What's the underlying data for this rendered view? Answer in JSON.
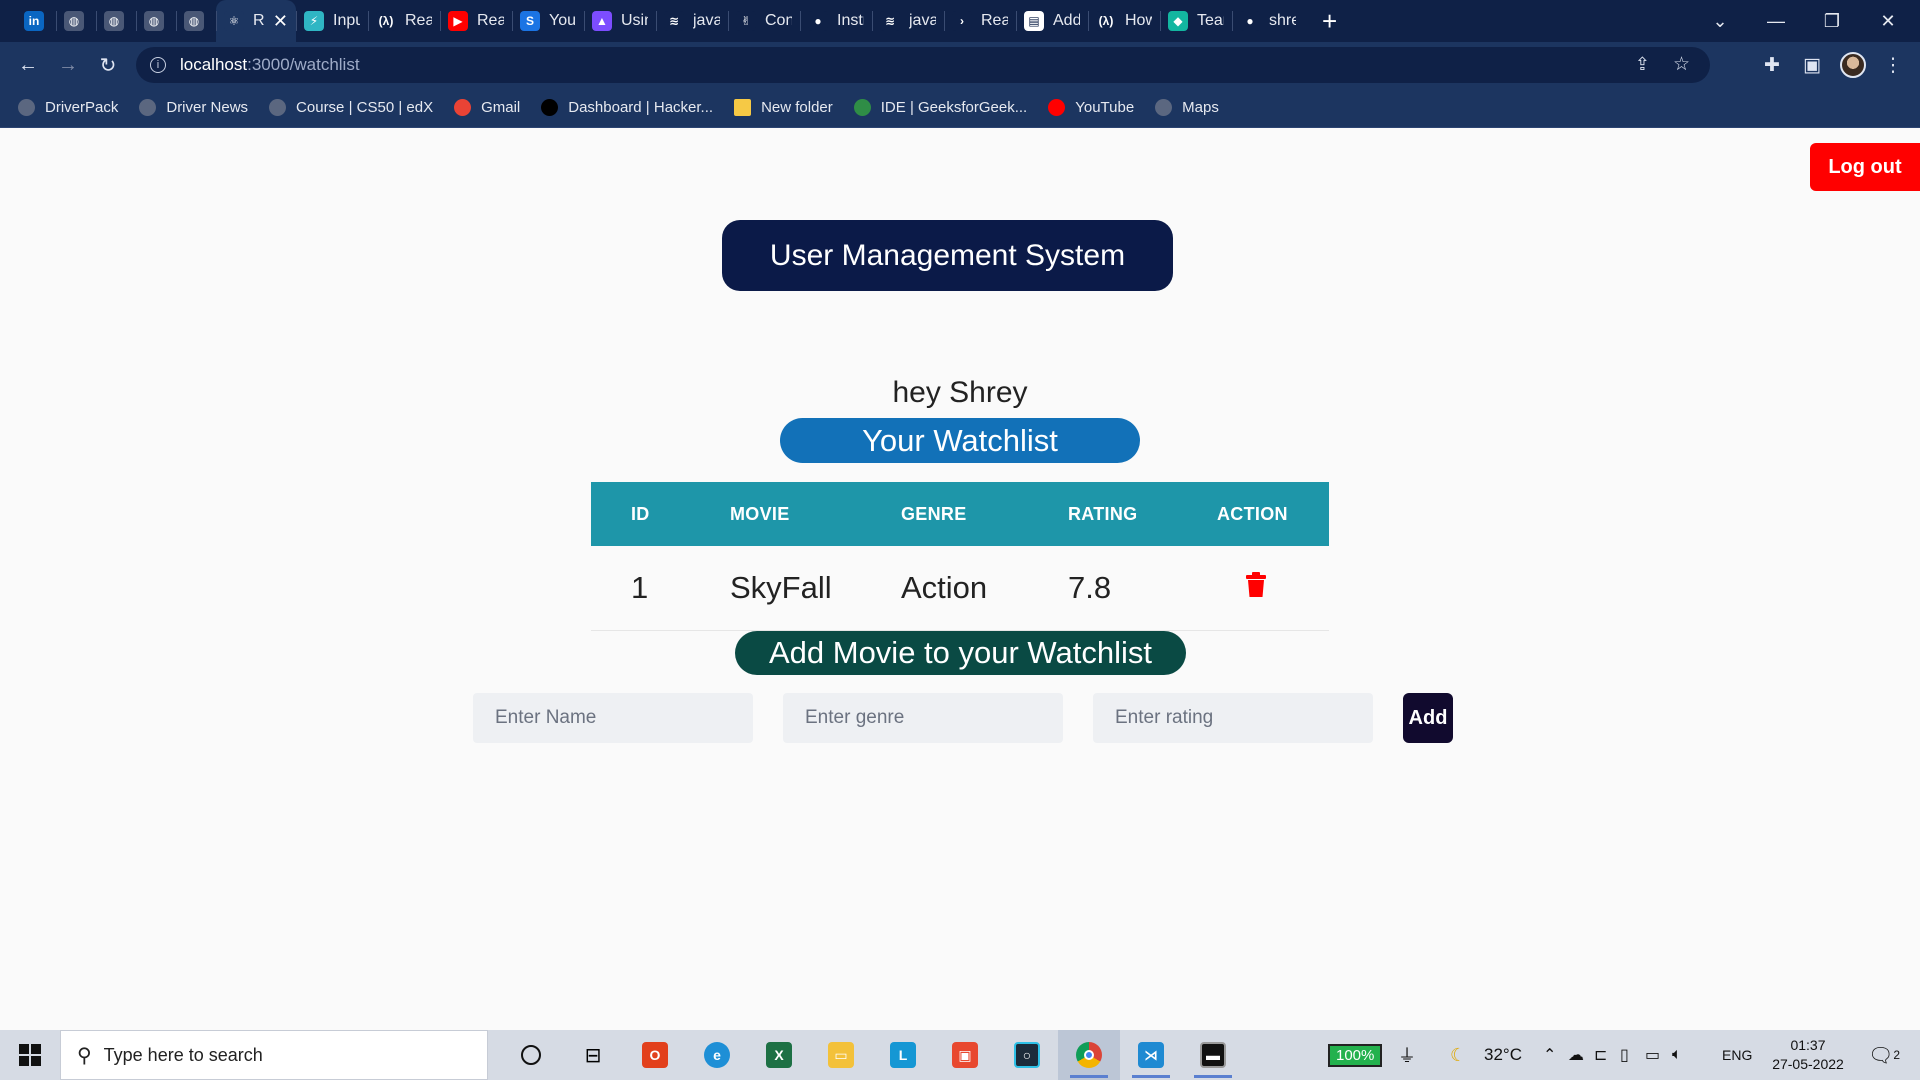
{
  "browser": {
    "tabs": [
      {
        "label": "",
        "icon": "linkedin-icon",
        "color": "#0a66c2",
        "glyph": "in"
      },
      {
        "label": "",
        "icon": "globe-icon",
        "color": "#4a5876",
        "glyph": "◍"
      },
      {
        "label": "",
        "icon": "globe-icon",
        "color": "#4a5876",
        "glyph": "◍"
      },
      {
        "label": "",
        "icon": "globe-icon",
        "color": "#4a5876",
        "glyph": "◍"
      },
      {
        "label": "",
        "icon": "globe-icon",
        "color": "#4a5876",
        "glyph": "◍"
      },
      {
        "label": "Re",
        "icon": "react-icon",
        "color": "#1c3560",
        "glyph": "⚛",
        "active": true
      },
      {
        "label": "Input",
        "icon": "lightning-icon",
        "color": "#2fb6c4",
        "glyph": "⚡"
      },
      {
        "label": "React",
        "icon": "fcc-icon",
        "color": "#0f2147",
        "glyph": "(λ)"
      },
      {
        "label": "React",
        "icon": "youtube-icon",
        "color": "#ff0000",
        "glyph": "▶"
      },
      {
        "label": "You h",
        "icon": "stackblitz-icon",
        "color": "#1b74e4",
        "glyph": "S"
      },
      {
        "label": "Using",
        "icon": "rocket-icon",
        "color": "#7c4dff",
        "glyph": "▲"
      },
      {
        "label": "javasc",
        "icon": "stackoverflow-icon",
        "color": "#0f2147",
        "glyph": "≋"
      },
      {
        "label": "Conve",
        "icon": "hand-icon",
        "color": "#0f2147",
        "glyph": "✌"
      },
      {
        "label": "Instru",
        "icon": "github-icon",
        "color": "#0f2147",
        "glyph": "●"
      },
      {
        "label": "javasc",
        "icon": "stackoverflow-icon",
        "color": "#0f2147",
        "glyph": "≋"
      },
      {
        "label": "React",
        "icon": "arrow-icon",
        "color": "#0f2147",
        "glyph": "›"
      },
      {
        "label": "Add a",
        "icon": "doc-icon",
        "color": "#ffffff",
        "glyph": "▤"
      },
      {
        "label": "How t",
        "icon": "fcc-icon",
        "color": "#0f2147",
        "glyph": "(λ)"
      },
      {
        "label": "Team",
        "icon": "diamond-icon",
        "color": "#13b6a0",
        "glyph": "◆"
      },
      {
        "label": "shrey",
        "icon": "github-icon",
        "color": "#0f2147",
        "glyph": "●"
      }
    ],
    "url_host": "localhost",
    "url_path": ":3000/watchlist",
    "bookmarks": [
      {
        "label": "DriverPack",
        "icon": "globe-icon",
        "color": "#5b6780"
      },
      {
        "label": "Driver News",
        "icon": "globe-icon",
        "color": "#5b6780"
      },
      {
        "label": "Course | CS50 | edX",
        "icon": "globe-icon",
        "color": "#5b6780"
      },
      {
        "label": "Gmail",
        "icon": "gmail-icon",
        "color": "#ea4335"
      },
      {
        "label": "Dashboard | Hacker...",
        "icon": "hackerrank-icon",
        "color": "#000000"
      },
      {
        "label": "New folder",
        "icon": "folder-icon",
        "color": "#f6c945"
      },
      {
        "label": "IDE | GeeksforGeek...",
        "icon": "gfg-icon",
        "color": "#2f8d46"
      },
      {
        "label": "YouTube",
        "icon": "youtube-icon",
        "color": "#ff0000"
      },
      {
        "label": "Maps",
        "icon": "globe-icon",
        "color": "#5b6780"
      }
    ]
  },
  "app": {
    "logout_label": "Log out",
    "title": "User Management System",
    "greeting": "hey Shrey",
    "watchlist_heading": "Your Watchlist",
    "table": {
      "headers": [
        "ID",
        "MOVIE",
        "GENRE",
        "RATING",
        "ACTION"
      ],
      "rows": [
        {
          "id": "1",
          "movie": "SkyFall",
          "genre": "Action",
          "rating": "7.8"
        }
      ]
    },
    "add_heading": "Add Movie to your Watchlist",
    "name_placeholder": "Enter Name",
    "genre_placeholder": "Enter genre",
    "rating_placeholder": "Enter rating",
    "add_label": "Add",
    "colors": {
      "title_bg": "#0b1a48",
      "watchlist_bg": "#1271b8",
      "table_header_bg": "#1e96a9",
      "add_heading_bg": "#0a4a44",
      "logout_bg": "#ff0000",
      "delete_icon": "#ff0000"
    }
  },
  "taskbar": {
    "search_placeholder": "Type here to search",
    "battery": "100%",
    "temperature": "32°C",
    "language": "ENG",
    "time": "01:37",
    "date": "27-05-2022",
    "notification_count": "2"
  }
}
